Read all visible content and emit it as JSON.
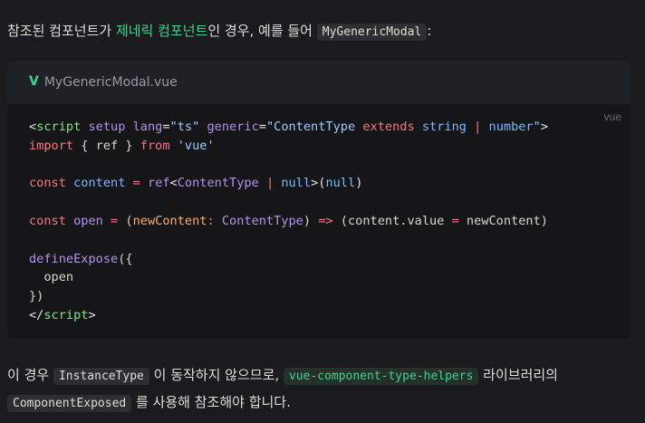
{
  "intro": {
    "prefix": "참조된 컴포넌트가 ",
    "link": "제네릭 컴포넌트",
    "middle": "인 경우, 예를 들어 ",
    "code": "MyGenericModal",
    "suffix": ":"
  },
  "code_block": {
    "filename": "MyGenericModal.vue",
    "lang": "vue",
    "lines": [
      [
        {
          "t": "<",
          "c": "t-punc"
        },
        {
          "t": "script",
          "c": "t-tagname"
        },
        {
          "t": " ",
          "c": "t-plain"
        },
        {
          "t": "setup",
          "c": "t-attr"
        },
        {
          "t": " ",
          "c": "t-plain"
        },
        {
          "t": "lang",
          "c": "t-attr"
        },
        {
          "t": "=",
          "c": "t-punc"
        },
        {
          "t": "\"ts\"",
          "c": "t-str"
        },
        {
          "t": " ",
          "c": "t-plain"
        },
        {
          "t": "generic",
          "c": "t-attr"
        },
        {
          "t": "=",
          "c": "t-punc"
        },
        {
          "t": "\"",
          "c": "t-str"
        },
        {
          "t": "ContentType",
          "c": "t-str"
        },
        {
          "t": " ",
          "c": "t-plain"
        },
        {
          "t": "extends",
          "c": "t-kw"
        },
        {
          "t": " ",
          "c": "t-plain"
        },
        {
          "t": "string",
          "c": "t-type"
        },
        {
          "t": " ",
          "c": "t-plain"
        },
        {
          "t": "|",
          "c": "t-op"
        },
        {
          "t": " ",
          "c": "t-plain"
        },
        {
          "t": "number",
          "c": "t-type"
        },
        {
          "t": "\"",
          "c": "t-str"
        },
        {
          "t": ">",
          "c": "t-punc"
        }
      ],
      [
        {
          "t": "import",
          "c": "t-kw"
        },
        {
          "t": " { ",
          "c": "t-plain"
        },
        {
          "t": "ref",
          "c": "t-plain"
        },
        {
          "t": " } ",
          "c": "t-plain"
        },
        {
          "t": "from",
          "c": "t-kw"
        },
        {
          "t": " ",
          "c": "t-plain"
        },
        {
          "t": "'vue'",
          "c": "t-str"
        }
      ],
      [],
      [
        {
          "t": "const",
          "c": "t-kw"
        },
        {
          "t": " ",
          "c": "t-plain"
        },
        {
          "t": "content",
          "c": "t-type"
        },
        {
          "t": " ",
          "c": "t-plain"
        },
        {
          "t": "=",
          "c": "t-op"
        },
        {
          "t": " ",
          "c": "t-plain"
        },
        {
          "t": "ref",
          "c": "t-fn"
        },
        {
          "t": "<",
          "c": "t-punc"
        },
        {
          "t": "ContentType",
          "c": "t-fn"
        },
        {
          "t": " ",
          "c": "t-plain"
        },
        {
          "t": "|",
          "c": "t-op"
        },
        {
          "t": " ",
          "c": "t-plain"
        },
        {
          "t": "null",
          "c": "t-lit"
        },
        {
          "t": ">(",
          "c": "t-punc"
        },
        {
          "t": "null",
          "c": "t-lit"
        },
        {
          "t": ")",
          "c": "t-punc"
        }
      ],
      [],
      [
        {
          "t": "const",
          "c": "t-kw"
        },
        {
          "t": " ",
          "c": "t-plain"
        },
        {
          "t": "open",
          "c": "t-fn"
        },
        {
          "t": " ",
          "c": "t-plain"
        },
        {
          "t": "=",
          "c": "t-op"
        },
        {
          "t": " (",
          "c": "t-plain"
        },
        {
          "t": "newContent",
          "c": "t-var"
        },
        {
          "t": ":",
          "c": "t-op"
        },
        {
          "t": " ",
          "c": "t-plain"
        },
        {
          "t": "ContentType",
          "c": "t-fn"
        },
        {
          "t": ") ",
          "c": "t-plain"
        },
        {
          "t": "=>",
          "c": "t-op"
        },
        {
          "t": " (content.value ",
          "c": "t-plain"
        },
        {
          "t": "=",
          "c": "t-op"
        },
        {
          "t": " newContent)",
          "c": "t-plain"
        }
      ],
      [],
      [
        {
          "t": "defineExpose",
          "c": "t-fn"
        },
        {
          "t": "({",
          "c": "t-plain"
        }
      ],
      [
        {
          "t": "  open",
          "c": "t-plain"
        }
      ],
      [
        {
          "t": "})",
          "c": "t-plain"
        }
      ],
      [
        {
          "t": "</",
          "c": "t-punc"
        },
        {
          "t": "script",
          "c": "t-tagname"
        },
        {
          "t": ">",
          "c": "t-punc"
        }
      ]
    ]
  },
  "outro": {
    "prefix": "이 경우 ",
    "code1": "InstanceType",
    "middle1": " 이 동작하지 않으므로, ",
    "code2": "vue-component-type-helpers",
    "middle2": " 라이브러리의 ",
    "code3": "ComponentExposed",
    "suffix": " 를 사용해 참조해야 합니다."
  },
  "colors": {
    "background": "#1b1b1f",
    "accent": "#3dd68c",
    "code_bg": "#161618",
    "title_bar_bg": "#202127"
  }
}
